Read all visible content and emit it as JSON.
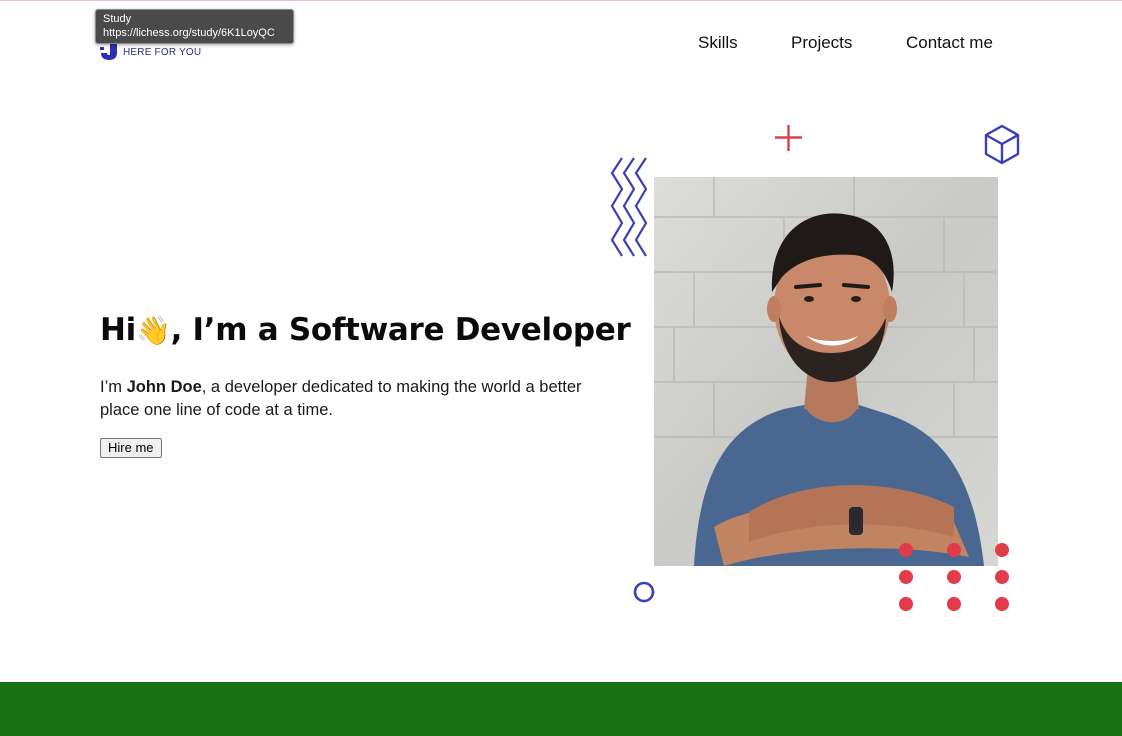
{
  "header": {
    "logo_tagline": "HERE FOR YOU",
    "logo_letter": "J",
    "tooltip": {
      "title": "Study",
      "url": "https://lichess.org/study/6K1LoyQC"
    }
  },
  "nav": {
    "items": [
      {
        "label": "Skills"
      },
      {
        "label": "Projects"
      },
      {
        "label": "Contact me"
      }
    ]
  },
  "hero": {
    "title_before": "Hi",
    "title_emoji": "👋",
    "title_after": ", I’m a Software Developer",
    "intro_before": "I’m ",
    "name": "John Doe",
    "intro_after": ", a developer dedicated to making the world a better place one line of code at a time.",
    "cta_label": "Hire me"
  },
  "colors": {
    "accent_red": "#e23b4a",
    "accent_blue": "#3b3fb6",
    "footer_green": "#177214",
    "logo_blue": "#2b2fb0"
  },
  "icons": {
    "wave": "waving-hand-icon",
    "cube": "cube-icon",
    "plus": "plus-icon",
    "zigzag": "zigzag-icon",
    "ring": "ring-icon",
    "dots": "dot-grid-icon"
  }
}
